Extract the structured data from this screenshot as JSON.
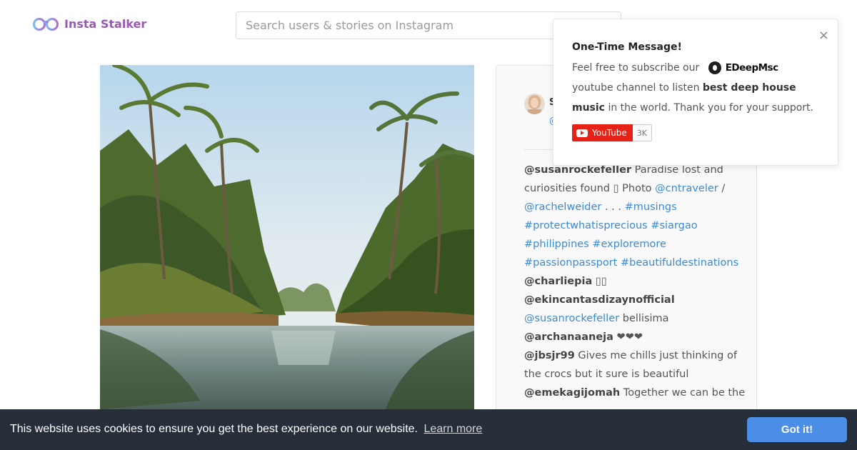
{
  "app": {
    "name": "Insta Stalker"
  },
  "search": {
    "placeholder": "Search users & stories on Instagram"
  },
  "post": {
    "author_name": "S",
    "author_handle": "@",
    "comments": [
      {
        "parts": [
          {
            "t": "@susanrockefeller",
            "k": "u"
          },
          {
            "t": " Paradise lost and",
            "k": "x"
          }
        ]
      },
      {
        "parts": [
          {
            "t": "curiosities found ",
            "k": "x"
          },
          {
            "t": "▯",
            "k": "x"
          },
          {
            "t": " Photo ",
            "k": "x"
          },
          {
            "t": "@cntraveler",
            "k": "tag"
          },
          {
            "t": " /",
            "k": "x"
          }
        ]
      },
      {
        "parts": [
          {
            "t": "@rachelweider",
            "k": "tag"
          },
          {
            "t": " . . . ",
            "k": "x"
          },
          {
            "t": "#musings",
            "k": "tag"
          }
        ]
      },
      {
        "parts": [
          {
            "t": "#protectwhatisprecious",
            "k": "tag"
          },
          {
            "t": " ",
            "k": "x"
          },
          {
            "t": "#siargao",
            "k": "tag"
          }
        ]
      },
      {
        "parts": [
          {
            "t": "#philippines",
            "k": "tag"
          },
          {
            "t": " ",
            "k": "x"
          },
          {
            "t": "#exploremore",
            "k": "tag"
          }
        ]
      },
      {
        "parts": [
          {
            "t": "#passionpassport",
            "k": "tag"
          },
          {
            "t": " ",
            "k": "x"
          },
          {
            "t": "#beautifuldestinations",
            "k": "tag"
          }
        ]
      },
      {
        "parts": [
          {
            "t": "@charliepia",
            "k": "u"
          },
          {
            "t": " ▯▯",
            "k": "x"
          }
        ]
      },
      {
        "parts": [
          {
            "t": "@ekincantasdizaynofficial",
            "k": "u"
          }
        ]
      },
      {
        "parts": [
          {
            "t": "@susanrockefeller",
            "k": "tag"
          },
          {
            "t": " bellisima",
            "k": "x"
          }
        ]
      },
      {
        "parts": [
          {
            "t": "@archanaaneja",
            "k": "u"
          },
          {
            "t": " ❤❤❤",
            "k": "x"
          }
        ]
      },
      {
        "parts": [
          {
            "t": "@jbsjr99",
            "k": "u"
          },
          {
            "t": " Gives me chills just thinking of",
            "k": "x"
          }
        ]
      },
      {
        "parts": [
          {
            "t": "the crocs but it sure is beautiful",
            "k": "x"
          }
        ]
      },
      {
        "parts": [
          {
            "t": "@emekagijomah",
            "k": "u"
          },
          {
            "t": " Together we can be the",
            "k": "x"
          }
        ]
      }
    ]
  },
  "popup": {
    "title": "One-Time Message!",
    "close": "×",
    "text_before": "Feel free to subscribe our",
    "channel_name": "EDeepMsc",
    "text_after": "youtube channel to listen",
    "highlight": "best deep house music",
    "text_end": "in the world. Thank you for your support.",
    "youtube_label": "YouTube",
    "youtube_count": "3K"
  },
  "cookie": {
    "message": "This website uses cookies to ensure you get the best experience on our website.",
    "link": "Learn more",
    "button": "Got it!"
  },
  "colors": {
    "brand": "#9b59b6",
    "link": "#3a8bd4",
    "cookie_bar": "#252e39",
    "cookie_button": "#4b8ee8",
    "youtube": "#e62117"
  },
  "icons": {
    "logo": "binoculars-icon",
    "close": "close-icon",
    "youtube": "youtube-play-icon"
  }
}
